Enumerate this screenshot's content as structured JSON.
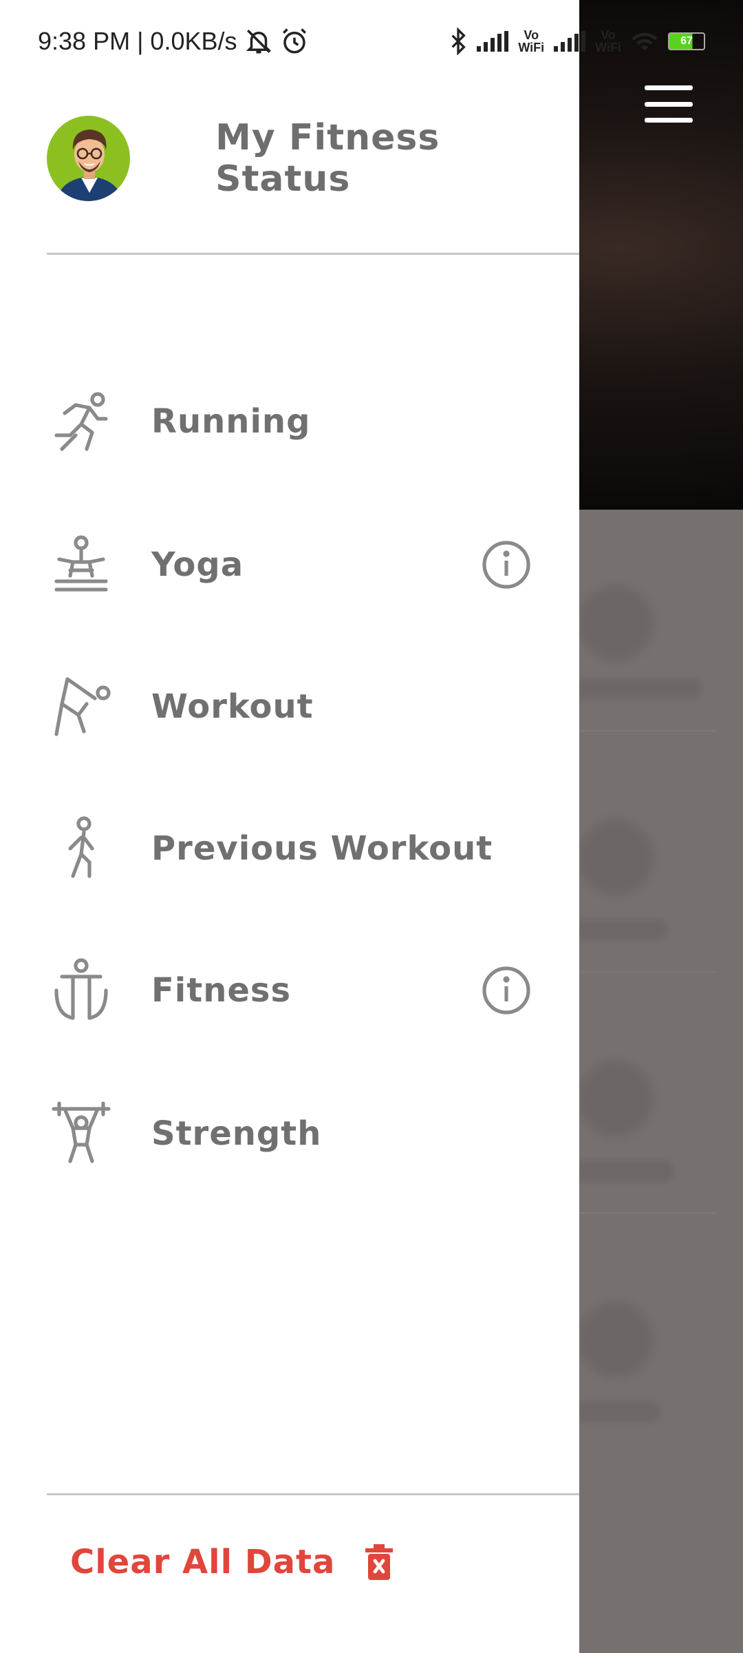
{
  "status_bar": {
    "time_speed": "9:38 PM | 0.0KB/s",
    "icons": [
      "mute-icon",
      "alarm-icon",
      "bluetooth-icon",
      "signal-icon",
      "vowifi-icon",
      "signal-icon",
      "vowifi-icon",
      "wifi-icon",
      "battery-icon"
    ],
    "vowifi_label": "Vo\nWiFi",
    "battery_level": "67",
    "battery_fraction": 0.67
  },
  "drawer": {
    "title": "My Fitness Status",
    "menu": [
      {
        "label": "Running",
        "icon": "running-icon",
        "info": false
      },
      {
        "label": "Yoga",
        "icon": "yoga-icon",
        "info": true
      },
      {
        "label": "Workout",
        "icon": "workout-icon",
        "info": false
      },
      {
        "label": "Previous Workout",
        "icon": "walking-icon",
        "info": false
      },
      {
        "label": "Fitness",
        "icon": "fitness-icon",
        "info": true
      },
      {
        "label": "Strength",
        "icon": "weightlifting-icon",
        "info": false
      }
    ],
    "clear_label": "Clear All Data"
  },
  "colors": {
    "accent_red": "#e0463b",
    "avatar_bg": "#8cc021",
    "menu_text": "#707070",
    "scrim": "#76706f"
  }
}
